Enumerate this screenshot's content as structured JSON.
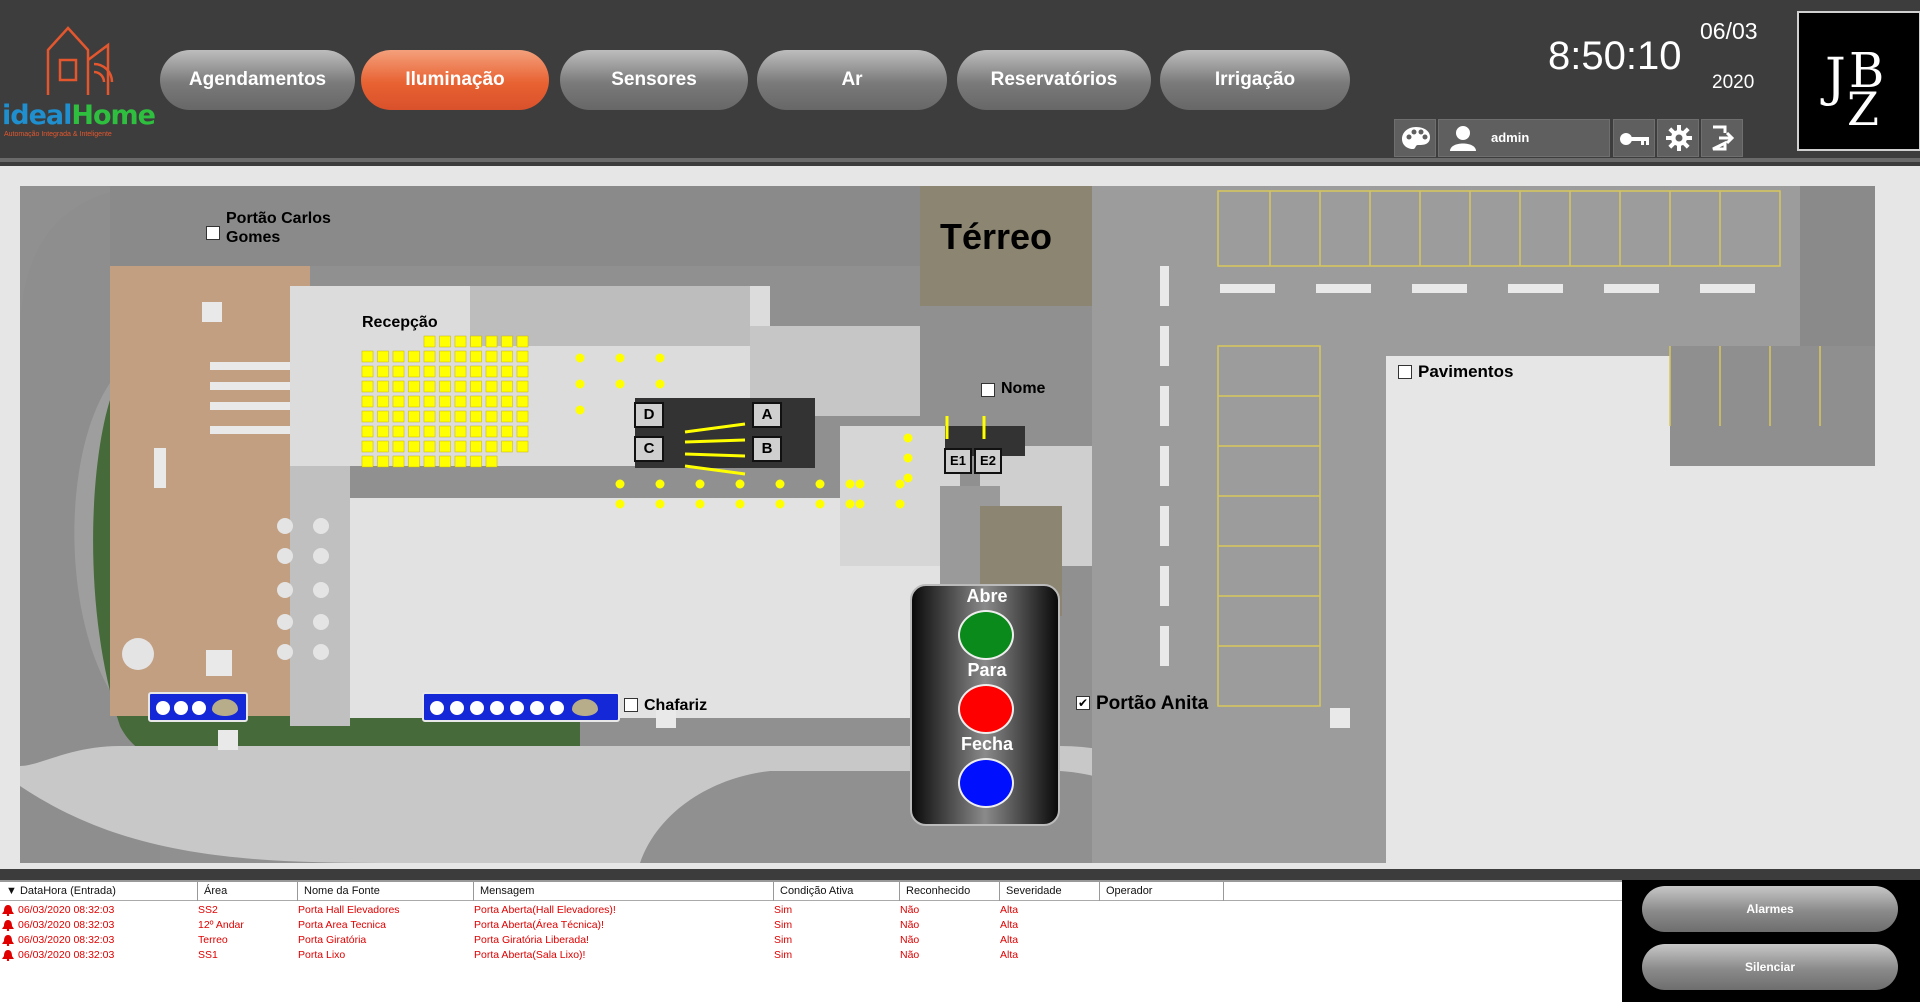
{
  "app": {
    "brand_part1": "ideal",
    "brand_part2": "Home",
    "tagline": "Automação Integrada & Inteligente",
    "corner_logo_text": "JBZ"
  },
  "nav": [
    {
      "label": "Agendamentos",
      "active": false
    },
    {
      "label": "Iluminação",
      "active": true
    },
    {
      "label": "Sensores",
      "active": false
    },
    {
      "label": "Ar",
      "active": false
    },
    {
      "label": "Reservatórios",
      "active": false
    },
    {
      "label": "Irrigação",
      "active": false
    }
  ],
  "status": {
    "time": "8:50:10",
    "date_day_month": "06/03",
    "date_year": "2020",
    "username": "admin"
  },
  "map": {
    "floor_title": "Térreo",
    "labels": {
      "portao_carlos_gomes": "Portão Carlos Gomes",
      "recepcao": "Recepção",
      "nome": "Nome",
      "pavimentos": "Pavimentos",
      "chafariz": "Chafariz",
      "portao_anita": "Portão Anita"
    },
    "checkboxes": {
      "portao_carlos_gomes": false,
      "nome": false,
      "pavimentos": false,
      "chafariz": false,
      "portao_anita": true
    },
    "elevators": [
      "D",
      "C",
      "A",
      "B",
      "E1",
      "E2"
    ],
    "gate_control": {
      "open_label": "Abre",
      "stop_label": "Para",
      "close_label": "Fecha",
      "open_color": "#0a8a1a",
      "stop_color": "#ff0000",
      "close_color": "#0010ff"
    },
    "light_on_color": "#ffff00"
  },
  "alarms": {
    "columns": [
      "DataHora (Entrada)",
      "Área",
      "Nome da Fonte",
      "Mensagem",
      "Condição Ativa",
      "Reconhecido",
      "Severidade",
      "Operador"
    ],
    "sort_indicator": "▼",
    "rows": [
      {
        "datetime": "06/03/2020 08:32:03",
        "area": "SS2",
        "source": "Porta Hall Elevadores",
        "message": "Porta Aberta(Hall Elevadores)!",
        "active": "Sim",
        "ack": "Não",
        "severity": "Alta"
      },
      {
        "datetime": "06/03/2020 08:32:03",
        "area": "12º Andar",
        "source": "Porta Area Tecnica",
        "message": "Porta Aberta(Área Técnica)!",
        "active": "Sim",
        "ack": "Não",
        "severity": "Alta"
      },
      {
        "datetime": "06/03/2020 08:32:03",
        "area": "Terreo",
        "source": "Porta Giratória",
        "message": "Porta Giratória Liberada!",
        "active": "Sim",
        "ack": "Não",
        "severity": "Alta"
      },
      {
        "datetime": "06/03/2020 08:32:03",
        "area": "SS1",
        "source": "Porta Lixo",
        "message": "Porta Aberta(Sala Lixo)!",
        "active": "Sim",
        "ack": "Não",
        "severity": "Alta"
      }
    ],
    "alarm_color": "#e00000",
    "buttons": {
      "alarms": "Alarmes",
      "silence": "Silenciar"
    }
  }
}
